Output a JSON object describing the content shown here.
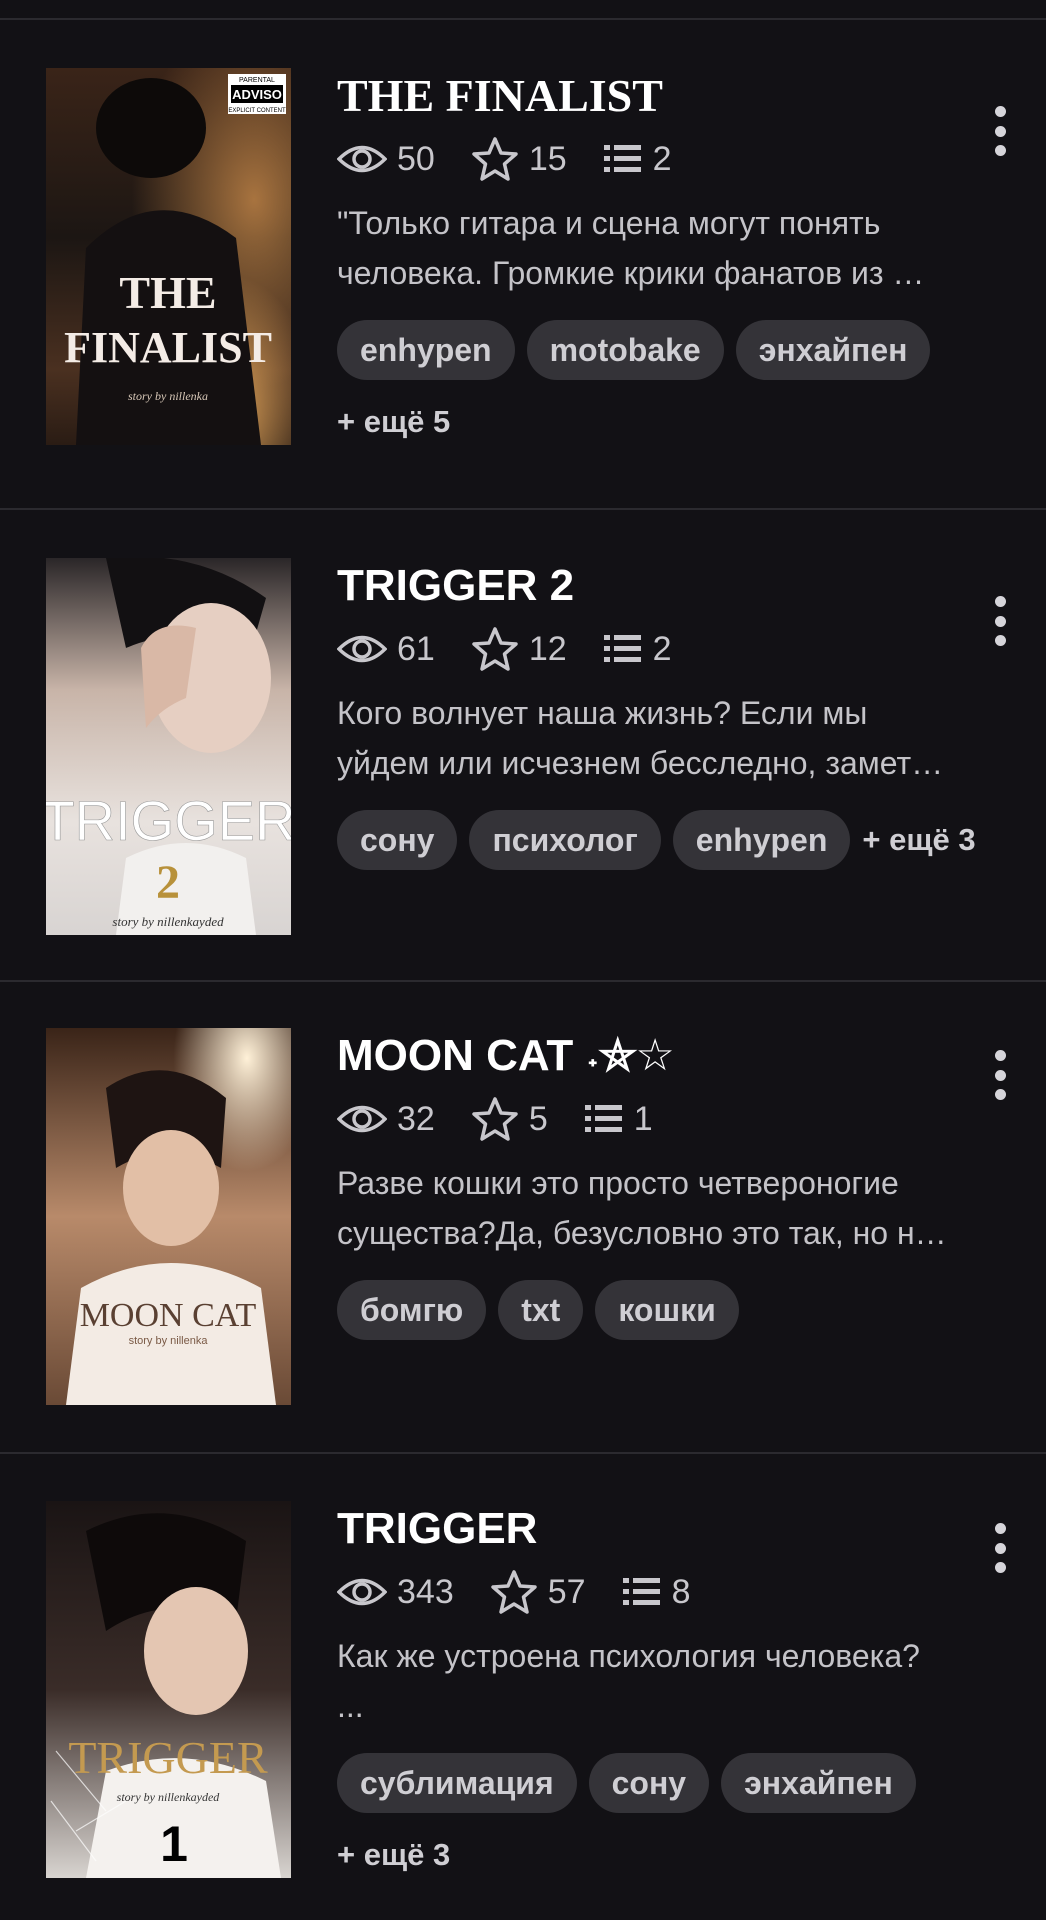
{
  "stories": [
    {
      "title": "THE FINALIST",
      "title_style": "serif",
      "views": "50",
      "votes": "15",
      "parts": "2",
      "description": [
        "\"Только гитара и сцена могут понять",
        "человека. Громкие крики фанатов из …"
      ],
      "tags": [
        "enhypen",
        "motobake",
        "энхайпен"
      ],
      "more": "+ ещё 5",
      "cover": {
        "line1": "THE",
        "line2": "FINALIST",
        "byline": "story by nillenka",
        "badge": "PARENTAL ADVISORY EXPLICIT CONTENT"
      }
    },
    {
      "title": "TRIGGER 2",
      "title_style": "sans",
      "views": "61",
      "votes": "12",
      "parts": "2",
      "description": [
        "Кого волнует наша жизнь? Если мы",
        "уйдем или исчезнем бесследно, замет…"
      ],
      "tags": [
        "сону",
        "психолог",
        "enhypen"
      ],
      "more": "+ ещё 3",
      "cover": {
        "line1": "TRIGGER",
        "line2": "2",
        "byline": "story by nillenkayded"
      }
    },
    {
      "title": "MOON CAT ˖⛤☆",
      "title_style": "sans",
      "views": "32",
      "votes": "5",
      "parts": "1",
      "description": [
        "Разве кошки это просто четвероногие",
        "существа?Да, безусловно это так, но н…"
      ],
      "tags": [
        "бомгю",
        "txt",
        "кошки"
      ],
      "more": "",
      "cover": {
        "line1": "MOON CAT",
        "line2": "",
        "byline": "story by nillenka"
      }
    },
    {
      "title": "TRIGGER",
      "title_style": "sans",
      "views": "343",
      "votes": "57",
      "parts": "8",
      "description": [
        "Как же устроена психология человека?",
        "..."
      ],
      "tags": [
        "сублимация",
        "сону",
        "энхайпен"
      ],
      "more": "+ ещё 3",
      "cover": {
        "line1": "TRIGGER",
        "line2": "1",
        "byline": "story by nillenkayded"
      }
    }
  ],
  "icons": {
    "views": "eye-icon",
    "votes": "star-icon",
    "parts": "list-icon",
    "menu": "more-vertical-icon"
  },
  "colors": {
    "background": "#121115",
    "tag_bg": "#343338",
    "text_secondary": "#c4c3c8"
  }
}
